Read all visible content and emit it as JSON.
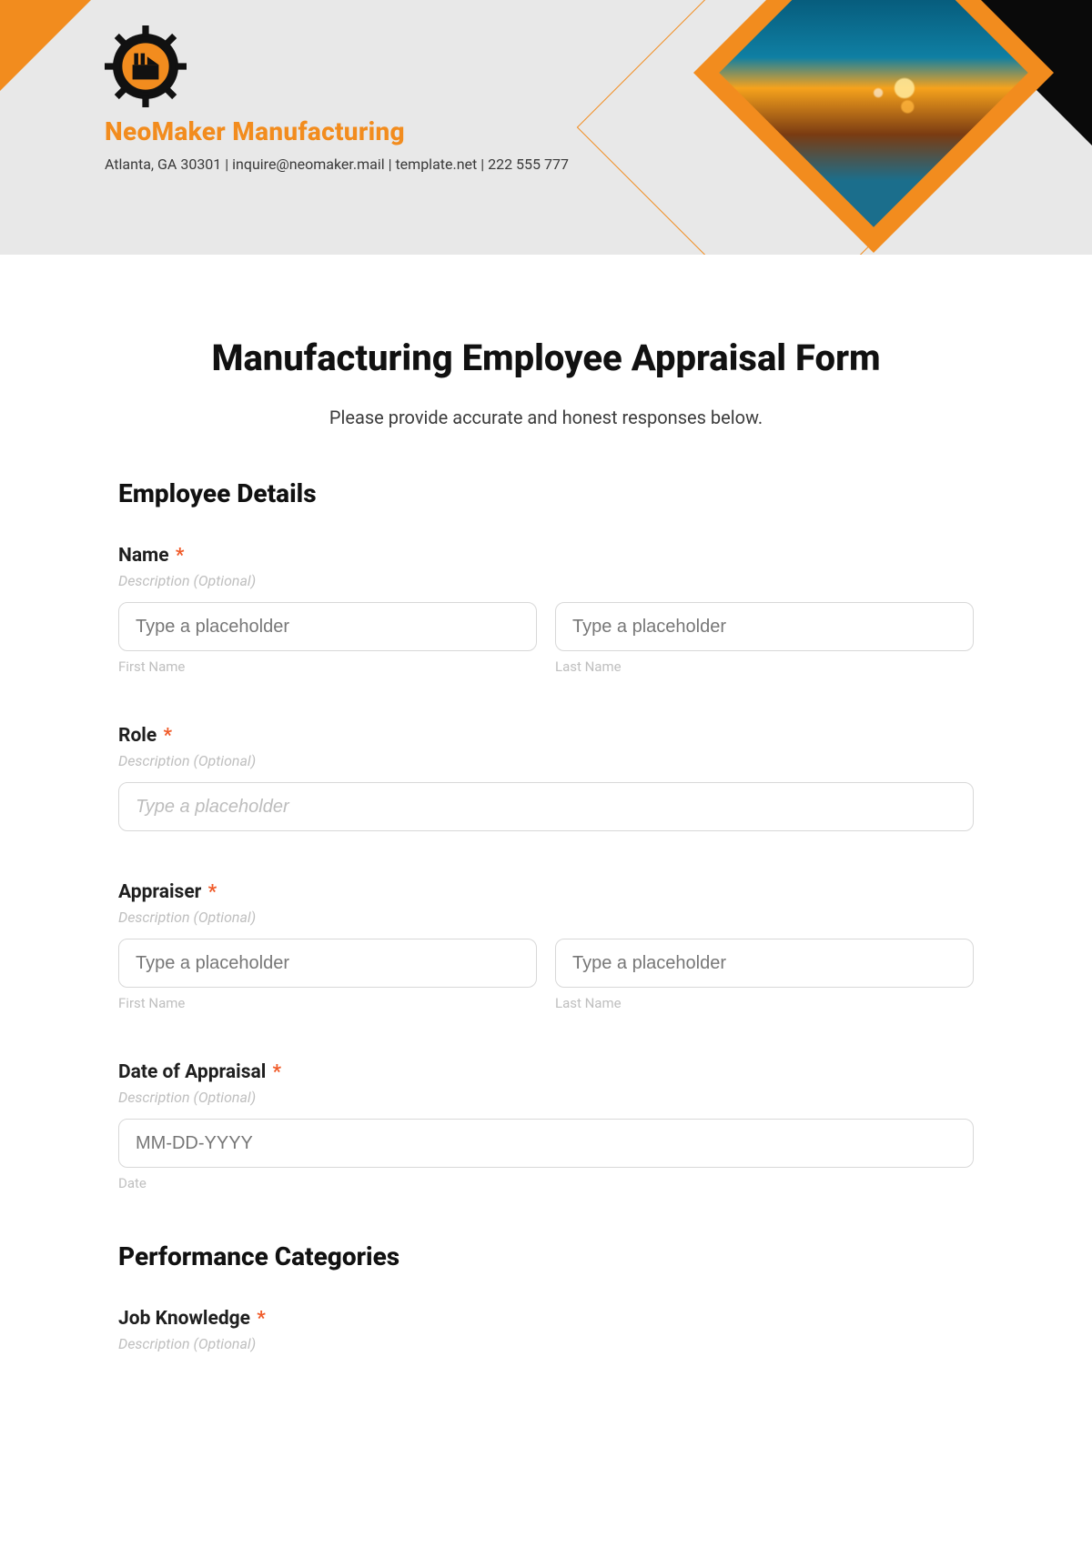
{
  "header": {
    "brand": "NeoMaker Manufacturing",
    "contact": "Atlanta, GA 30301 | inquire@neomaker.mail | template.net | 222 555 777"
  },
  "form": {
    "title": "Manufacturing Employee Appraisal Form",
    "subtitle": "Please provide accurate and honest responses below.",
    "sections": {
      "employee_details": {
        "heading": "Employee Details",
        "name": {
          "label": "Name",
          "required_mark": "*",
          "description": "Description (Optional)",
          "first_placeholder": "Type a placeholder",
          "first_sub": "First Name",
          "last_placeholder": "Type a placeholder",
          "last_sub": "Last Name"
        },
        "role": {
          "label": "Role",
          "required_mark": "*",
          "description": "Description (Optional)",
          "placeholder": "Type a placeholder"
        },
        "appraiser": {
          "label": "Appraiser",
          "required_mark": "*",
          "description": "Description (Optional)",
          "first_placeholder": "Type a placeholder",
          "first_sub": "First Name",
          "last_placeholder": "Type a placeholder",
          "last_sub": "Last Name"
        },
        "date": {
          "label": "Date of Appraisal",
          "required_mark": "*",
          "description": "Description (Optional)",
          "placeholder": "MM-DD-YYYY",
          "sub": "Date"
        }
      },
      "performance": {
        "heading": "Performance Categories",
        "job_knowledge": {
          "label": "Job Knowledge",
          "required_mark": "*",
          "description": "Description (Optional)"
        }
      }
    }
  }
}
